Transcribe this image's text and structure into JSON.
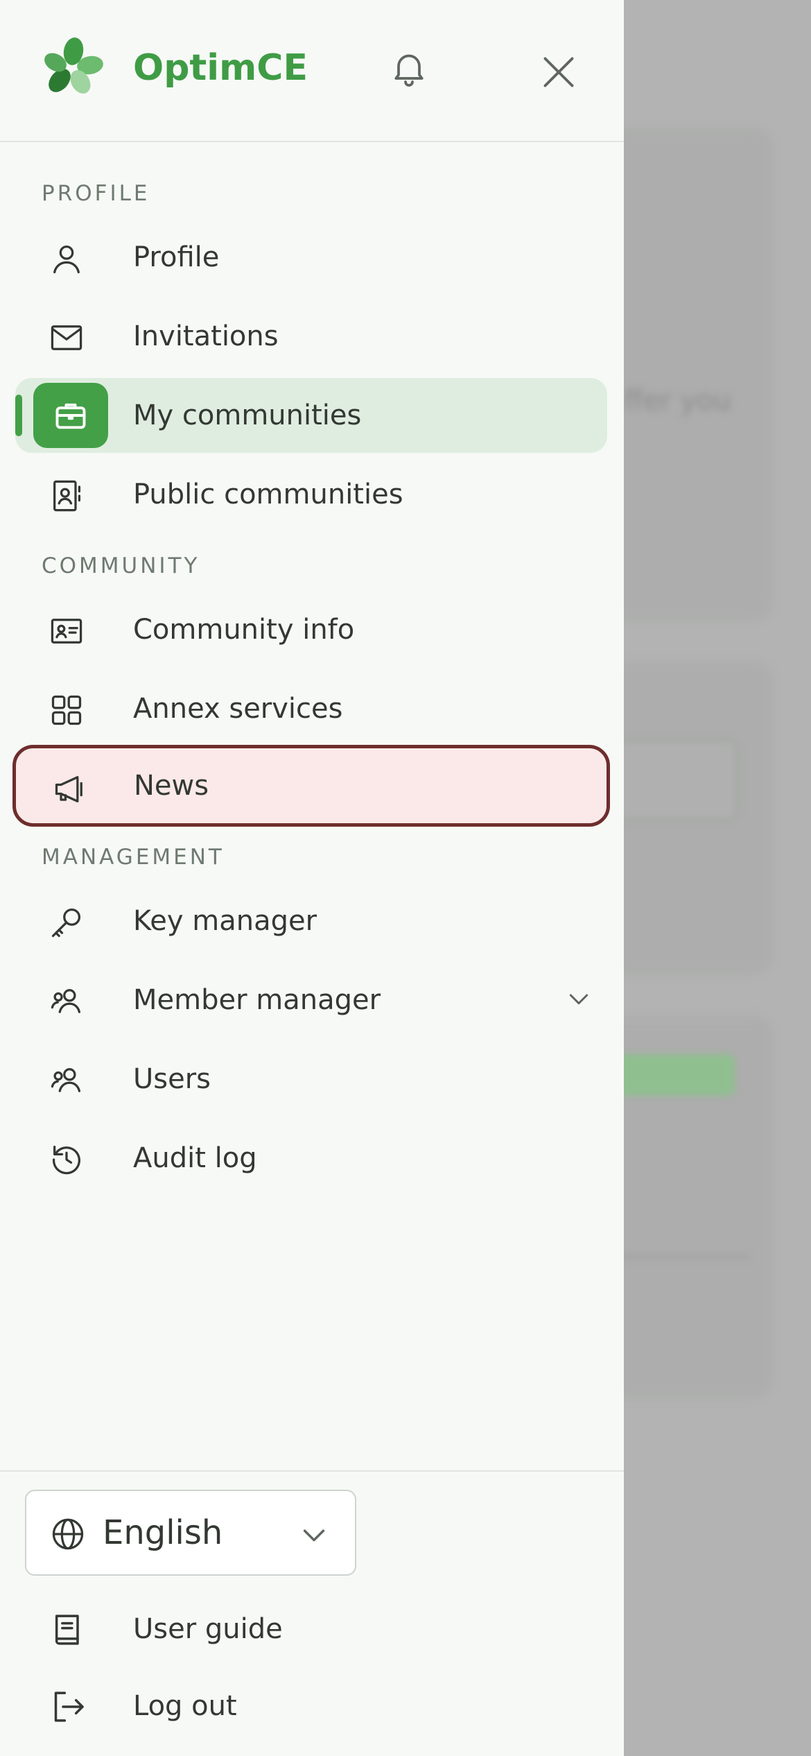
{
  "app": {
    "brand": "OptimCE",
    "accent": "#43a047"
  },
  "header": {
    "notifications_icon": "bell-icon",
    "close_icon": "close-icon"
  },
  "sections": {
    "profile": "PROFILE",
    "community": "COMMUNITY",
    "management": "MANAGEMENT"
  },
  "nav": {
    "profile": "Profile",
    "invitations": "Invitations",
    "my_communities": "My communities",
    "public_communities": "Public communities",
    "community_info": "Community info",
    "annex_services": "Annex services",
    "news": "News",
    "key_manager": "Key manager",
    "member_manager": "Member manager",
    "users": "Users",
    "audit_log": "Audit log"
  },
  "footer": {
    "language": "English",
    "user_guide": "User guide",
    "log_out": "Log out"
  }
}
